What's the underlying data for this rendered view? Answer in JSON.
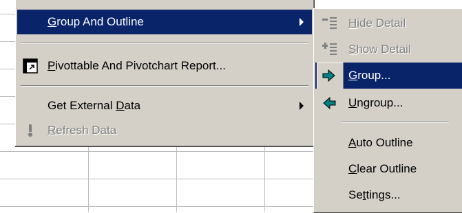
{
  "main_menu": {
    "items": [
      {
        "label": "Group And Outline",
        "hotkey": "G",
        "selected": true,
        "has_submenu": true
      },
      {
        "label": "Pivottable And Pivotchart Report...",
        "hotkey": "P",
        "icon": "pivottable-icon"
      },
      {
        "label": "Get External Data",
        "hotkey": "D",
        "has_submenu": true
      },
      {
        "label": "Refresh Data",
        "hotkey": "R",
        "disabled": true,
        "icon": "refresh-data-icon"
      }
    ]
  },
  "submenu": {
    "items": [
      {
        "label": "Hide Detail",
        "hotkey": "H",
        "disabled": true,
        "icon": "hide-detail-icon"
      },
      {
        "label": "Show Detail",
        "hotkey": "S",
        "disabled": true,
        "icon": "show-detail-icon"
      },
      {
        "label": "Group...",
        "hotkey": "G",
        "selected": true,
        "icon": "group-arrow-icon"
      },
      {
        "label": "Ungroup...",
        "hotkey": "U",
        "icon": "ungroup-arrow-icon"
      },
      {
        "label": "Auto Outline",
        "hotkey": "A"
      },
      {
        "label": "Clear Outline",
        "hotkey": "C"
      },
      {
        "label": "Settings...",
        "hotkey": "t"
      }
    ]
  },
  "colors": {
    "menu_face": "#d4d0c8",
    "selection": "#0a246a",
    "disabled_text": "#808080",
    "arrow_teal": "#008080"
  }
}
